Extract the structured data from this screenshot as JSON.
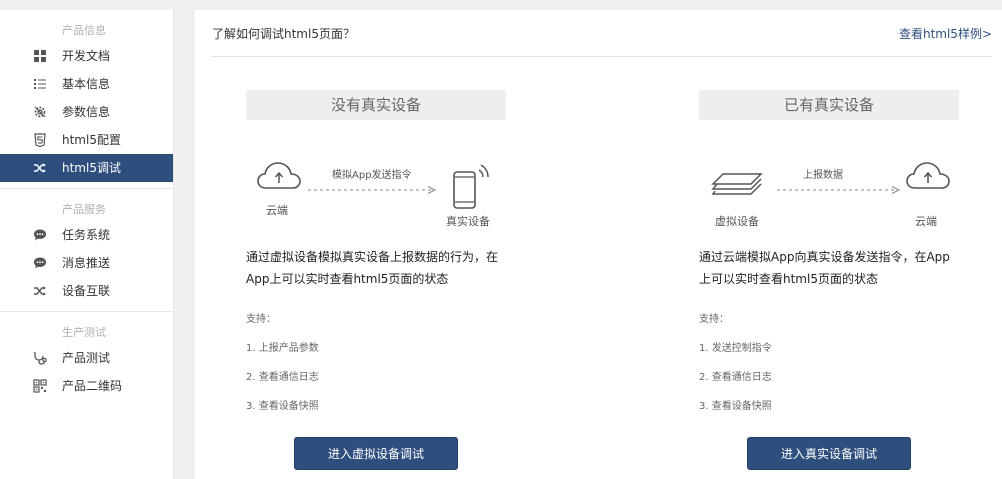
{
  "sidebar": {
    "groups": [
      {
        "title": "产品信息",
        "items": [
          {
            "label": "开发文档",
            "icon": "grid-icon"
          },
          {
            "label": "基本信息",
            "icon": "list-icon"
          },
          {
            "label": "参数信息",
            "icon": "gear-icon"
          },
          {
            "label": "html5配置",
            "icon": "html5-icon"
          },
          {
            "label": "html5调试",
            "icon": "shuffle-icon",
            "active": true
          }
        ]
      },
      {
        "title": "产品服务",
        "items": [
          {
            "label": "任务系统",
            "icon": "chat-icon"
          },
          {
            "label": "消息推送",
            "icon": "chat-icon"
          },
          {
            "label": "设备互联",
            "icon": "shuffle-icon"
          }
        ]
      },
      {
        "title": "生产测试",
        "items": [
          {
            "label": "产品测试",
            "icon": "stethoscope-icon"
          },
          {
            "label": "产品二维码",
            "icon": "qrcode-icon"
          }
        ]
      }
    ]
  },
  "main": {
    "title": "了解如何调试html5页面？",
    "example_link": "查看html5样例>",
    "panels": [
      {
        "title": "没有真实设备",
        "from_label": "云端",
        "to_label": "真实设备",
        "arrow_label": "模拟App发送指令",
        "description": "通过虚拟设备模拟真实设备上报数据的行为，在App上可以实时查看html5页面的状态",
        "support_title": "支持：",
        "support_items": [
          "1. 上报产品参数",
          "2. 查看通信日志",
          "3. 查看设备快照"
        ],
        "button": "进入虚拟设备调试"
      },
      {
        "title": "已有真实设备",
        "from_label": "虚拟设备",
        "to_label": "云端",
        "arrow_label": "上报数据",
        "description": "通过云端模拟App向真实设备发送指令，在App上可以实时查看html5页面的状态",
        "support_title": "支持：",
        "support_items": [
          "1. 发送控制指令",
          "2. 查看通信日志",
          "3. 查看设备快照"
        ],
        "button": "进入真实设备调试"
      }
    ]
  },
  "colors": {
    "accent": "#2e4e7e",
    "background": "#f0f0f0",
    "panel_title_bg": "#eeeeee"
  }
}
